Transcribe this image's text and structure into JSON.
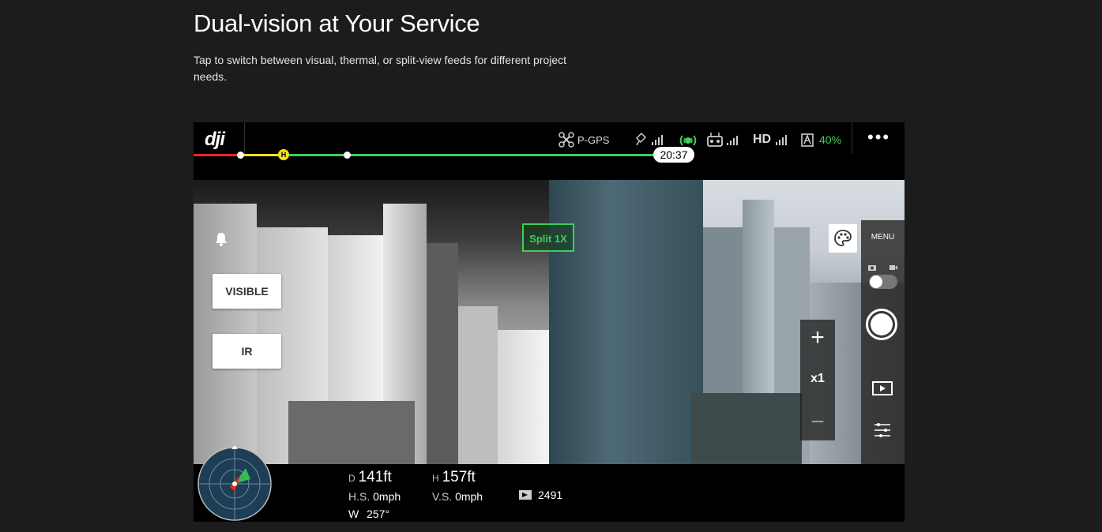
{
  "page": {
    "title": "Dual-vision at Your Service",
    "description": "Tap to switch between visual, thermal, or split-view feeds for different project needs."
  },
  "app": {
    "logo": "dji",
    "status": {
      "gps_mode": "P-GPS",
      "hd_label": "HD",
      "battery": "40%"
    },
    "flight_timer": "20:37",
    "home_marker": "H",
    "view_label": "Split 1X",
    "modes": {
      "visible": "VISIBLE",
      "ir": "IR"
    },
    "zoom": {
      "plus": "+",
      "value": "x1",
      "minus": "−"
    },
    "menu_label": "MENU",
    "telemetry": {
      "d_label": "D",
      "d_value": "141ft",
      "h_label": "H",
      "h_value": "157ft",
      "hs_label": "H.S.",
      "hs_value": "0mph",
      "vs_label": "V.S.",
      "vs_value": "0mph",
      "w_label": "W",
      "w_value": "257°",
      "photo_count": "2491"
    },
    "colors": {
      "accent": "#3ecf55",
      "warning": "#f2e21c",
      "danger": "#e8261b"
    }
  }
}
